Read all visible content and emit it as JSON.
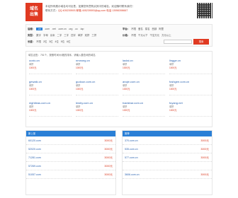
{
  "header": {
    "logo_line1": "域名",
    "logo_line2": "出售",
    "intro_line1": "本站所有展示域名均可出售，如果您有意购买其中的域名，欢迎随时联系我们！",
    "intro_line2_prefix": "联系方式：",
    "intro_line2_highlight": "QQ 405239593 邮箱 405239593@qq.com 电话 13956398667"
  },
  "filter": {
    "r1_label": "后缀：",
    "r1_options": [
      ".cn",
      ".com",
      ".net",
      ".com.cn",
      ".org",
      ".cc",
      ".top"
    ],
    "r1_selected": ".cn",
    "r1b_label": "平台：",
    "r1b_options": [
      "不限",
      "爱名",
      "易名",
      "西部",
      "阿里"
    ],
    "r2_label": "类型：",
    "r2_options": [
      "数字",
      "字母",
      "杂米",
      "二字",
      "三字",
      "四字",
      "单拼",
      "双拼",
      "三拼"
    ],
    "r2b_label": "价格：",
    "r2b_options": [
      "不限",
      "千元以下",
      "千至万元",
      "万元以上"
    ],
    "r3_label": "长度：",
    "r3_options": [
      "不限",
      "2位",
      "3位",
      "4位",
      "5位",
      "6位"
    ],
    "search_button": "搜索"
  },
  "results": {
    "crumb": "域名出售：751个，按照时间/价格的排序，请输入要查询的域名",
    "items": [
      {
        "domain": "ooxiu.cn",
        "tag": "单拼",
        "price": "1000元"
      },
      {
        "domain": "nrrwong.cn",
        "tag": "单拼",
        "price": "1000元"
      },
      {
        "domain": "laolai.cn",
        "tag": "单拼",
        "price": "1000元"
      },
      {
        "domain": "lingge.cn",
        "tag": "单拼",
        "price": "1000元"
      },
      {
        "domain": "gewaik.cn",
        "tag": "单拼",
        "price": "1000元"
      },
      {
        "domain": "gudoun.com.cn",
        "tag": "单拼",
        "price": "1000元"
      },
      {
        "domain": "anqie.com.cn",
        "tag": "单拼",
        "price": "1000元"
      },
      {
        "domain": "foshgee.com.cn",
        "tag": "单拼",
        "price": "1000元"
      },
      {
        "domain": "nightleas.com.cn",
        "tag": "单拼",
        "price": "1000元"
      },
      {
        "domain": "lewhy.com.cn",
        "tag": "单拼",
        "price": "1000元"
      },
      {
        "domain": "tvankbar.com.cn",
        "tag": "单拼",
        "price": "1000元"
      },
      {
        "domain": "fuyang.net",
        "tag": "单拼",
        "price": "1000元"
      }
    ]
  },
  "panel_left": {
    "title": "新上架",
    "rows": [
      {
        "name": "60120.com",
        "desc": "",
        "price": "3000元"
      },
      {
        "name": "52020.com",
        "desc": "",
        "price": "3000元"
      },
      {
        "name": "71281.com",
        "desc": "",
        "price": "3000元"
      },
      {
        "name": "57269.com",
        "desc": "",
        "price": "3000元"
      },
      {
        "name": "51057.com",
        "desc": "",
        "price": "3000元"
      }
    ]
  },
  "panel_right": {
    "title": "推荐",
    "rows": [
      {
        "name": "370.com.cn",
        "desc": "",
        "price": "3000元"
      },
      {
        "name": "535.com.cn",
        "desc": "",
        "price": "3000元"
      },
      {
        "name": "577.com.cn",
        "desc": "",
        "price": "3000元"
      },
      {
        "name": "",
        "desc": "",
        "price": ""
      },
      {
        "name": "3606.com.cn",
        "desc": "",
        "price": "3000元"
      }
    ]
  },
  "colors": {
    "brand_red": "#e03a22",
    "accent_blue": "#2a7fd6",
    "link_blue": "#2a62b0"
  }
}
